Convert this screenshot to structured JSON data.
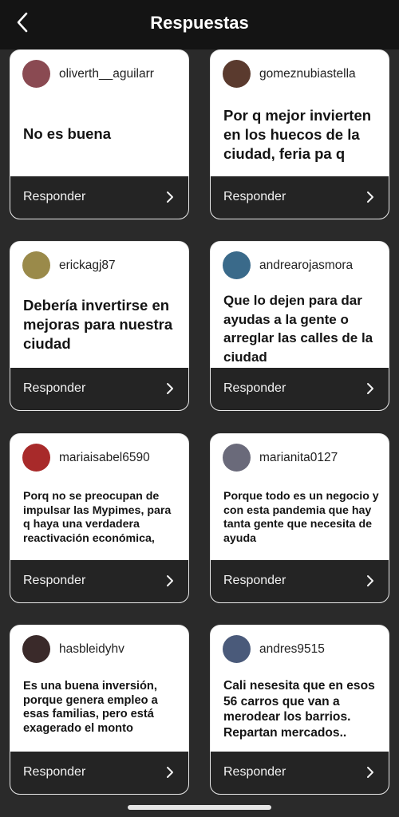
{
  "header": {
    "title": "Respuestas",
    "back_icon": "chevron-left-icon"
  },
  "reply_button_label": "Responder",
  "cards": [
    {
      "username": "oliverth__aguilarr",
      "answer": "No es buena",
      "avatar_color": "#8a4a52"
    },
    {
      "username": "gomeznubiastella",
      "answer": "Por q mejor invierten en los huecos de la ciudad, feria pa q",
      "avatar_color": "#5a3a2e"
    },
    {
      "username": "erickagj87",
      "answer": "Debería invertirse en mejoras para nuestra ciudad",
      "avatar_color": "#9a8a4a"
    },
    {
      "username": "andrearojasmora",
      "answer": "Que lo dejen para dar ayudas a la gente o arreglar las calles de la ciudad",
      "avatar_color": "#3a6a8a"
    },
    {
      "username": "mariaisabel6590",
      "answer": "Porq no se preocupan de impulsar las Mypimes, para q haya una verdadera reactivación económica,",
      "avatar_color": "#a82a2a"
    },
    {
      "username": "marianita0127",
      "answer": "Porque todo es un negocio y con esta pandemia que hay tanta gente que necesita de ayuda",
      "avatar_color": "#6a6a7a"
    },
    {
      "username": "hasbleidyhv",
      "answer": "Es una buena inversión, porque genera empleo a esas familias, pero está exagerado el monto",
      "avatar_color": "#3a2a2a"
    },
    {
      "username": "andres9515",
      "answer": "Cali nesesita que en esos 56 carros que van a merodear los barrios. Repartan mercados..",
      "avatar_color": "#4a5a7a"
    }
  ]
}
